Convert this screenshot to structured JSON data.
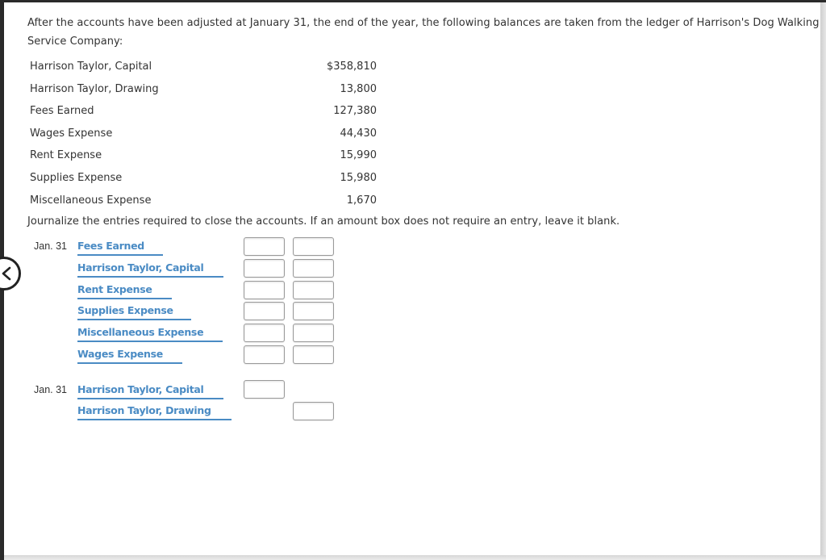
{
  "problem": {
    "intro": "After the accounts have been adjusted at January 31, the end of the year, the following balances are taken from the ledger of Harrison's Dog Walking Service Company:",
    "ledger": [
      {
        "account": "Harrison Taylor, Capital",
        "amount": "$358,810"
      },
      {
        "account": "Harrison Taylor, Drawing",
        "amount": "13,800"
      },
      {
        "account": "Fees Earned",
        "amount": "127,380"
      },
      {
        "account": "Wages Expense",
        "amount": "44,430"
      },
      {
        "account": "Rent Expense",
        "amount": "15,990"
      },
      {
        "account": "Supplies Expense",
        "amount": "15,980"
      },
      {
        "account": "Miscellaneous Expense",
        "amount": "1,670"
      }
    ],
    "instruction": "Journalize the entries required to close the accounts. If an amount box does not require an entry, leave it blank."
  },
  "journal": {
    "entry1": {
      "date": "Jan. 31",
      "lines": [
        {
          "account": "Fees Earned",
          "debit": "",
          "credit": ""
        },
        {
          "account": "Harrison Taylor, Capital",
          "debit": "",
          "credit": ""
        },
        {
          "account": "Rent Expense",
          "debit": "",
          "credit": ""
        },
        {
          "account": "Supplies Expense",
          "debit": "",
          "credit": ""
        },
        {
          "account": "Miscellaneous Expense",
          "debit": "",
          "credit": ""
        },
        {
          "account": "Wages Expense",
          "debit": "",
          "credit": ""
        }
      ]
    },
    "entry2": {
      "date": "Jan. 31",
      "lines": [
        {
          "account": "Harrison Taylor, Capital",
          "debit": ""
        },
        {
          "account": "Harrison Taylor, Drawing",
          "credit": ""
        }
      ]
    }
  },
  "navigation": {
    "back_icon": "chevron-left-icon"
  }
}
